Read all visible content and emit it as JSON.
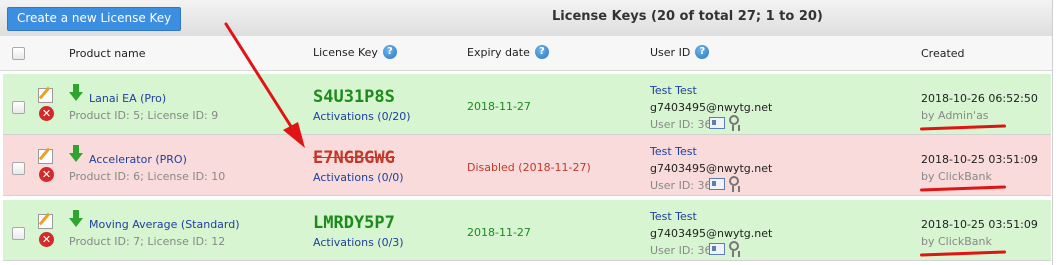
{
  "toolbar": {
    "create_label": "Create a new License Key"
  },
  "table": {
    "title": "License Keys (20 of total 27; 1 to 20)",
    "headers": {
      "product": "Product name",
      "license": "License Key",
      "expiry": "Expiry date",
      "user": "User ID",
      "created": "Created"
    }
  },
  "rows": [
    {
      "status": "active",
      "product_name": "Lanai EA (Pro)",
      "product_ids": "Product ID: 5; License ID: 9",
      "license_key": "S4U31P8S",
      "activations": "Activations (0/20)",
      "expiry": "2018-11-27",
      "user_name": "Test Test",
      "user_email": "g7403495@nwytg.net",
      "user_id": "User ID: 36",
      "created": "2018-10-26 06:52:50",
      "created_by": "by Admin'as"
    },
    {
      "status": "disabled",
      "product_name": "Accelerator (PRO)",
      "product_ids": "Product ID: 6; License ID: 10",
      "license_key": "E7NGBGWG",
      "activations": "Activations (0/0)",
      "expiry": "Disabled (2018-11-27)",
      "user_name": "Test Test",
      "user_email": "g7403495@nwytg.net",
      "user_id": "User ID: 36",
      "created": "2018-10-25 03:51:09",
      "created_by": "by ClickBank"
    },
    {
      "status": "active",
      "product_name": "Moving Average (Standard)",
      "product_ids": "Product ID: 7; License ID: 12",
      "license_key": "LMRDY5P7",
      "activations": "Activations (0/3)",
      "expiry": "2018-11-27",
      "user_name": "Test Test",
      "user_email": "g7403495@nwytg.net",
      "user_id": "User ID: 36",
      "created": "2018-10-25 03:51:09",
      "created_by": "by ClickBank"
    }
  ],
  "colors": {
    "active_row": "#d6f5d0",
    "disabled_row": "#fadbdb",
    "active_key": "#1e8a1e",
    "disabled_key": "#c0392b",
    "annotation": "#e01414",
    "link": "#1f3f9e"
  },
  "icons": [
    "edit-icon",
    "delete-icon",
    "download-arrow-icon",
    "help-icon",
    "user-card-icon",
    "badge-icon"
  ]
}
